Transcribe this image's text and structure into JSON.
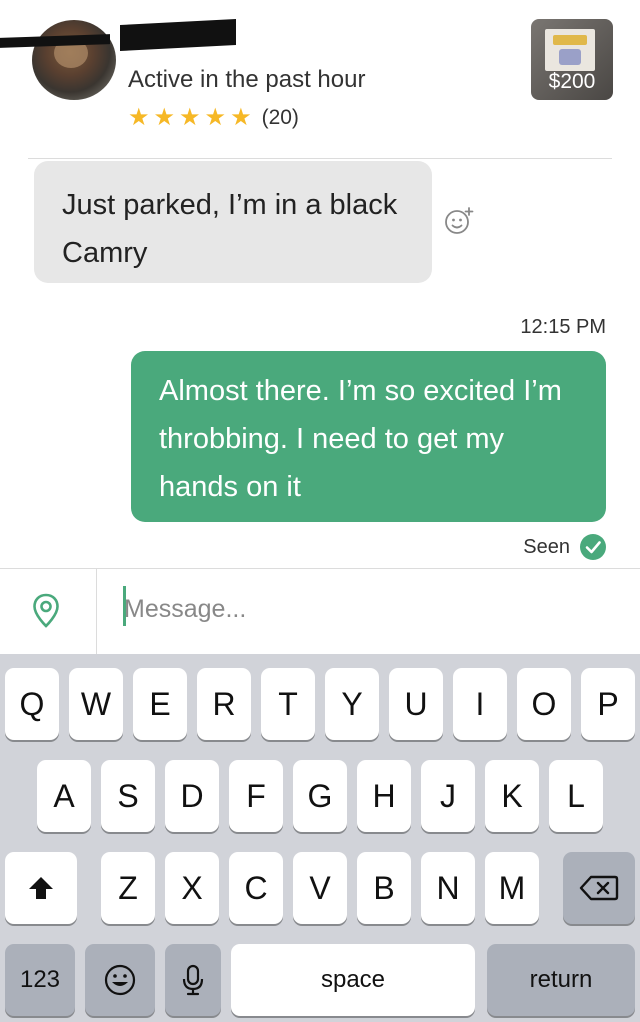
{
  "header": {
    "status": "Active in the past hour",
    "rating_count": "(20)",
    "stars": 5,
    "listing_price": "$200"
  },
  "messages": {
    "incoming_text": "Just parked, I’m in a black Camry",
    "timestamp": "12:15 PM",
    "outgoing_text": "Almost there. I’m so excited I’m throbbing. I need to get my hands on it",
    "seen_label": "Seen"
  },
  "composer": {
    "placeholder": "Message..."
  },
  "keyboard": {
    "row1": [
      "Q",
      "W",
      "E",
      "R",
      "T",
      "Y",
      "U",
      "I",
      "O",
      "P"
    ],
    "row2": [
      "A",
      "S",
      "D",
      "F",
      "G",
      "H",
      "J",
      "K",
      "L"
    ],
    "row3": [
      "Z",
      "X",
      "C",
      "V",
      "B",
      "N",
      "M"
    ],
    "numbers_label": "123",
    "space_label": "space",
    "return_label": "return"
  },
  "colors": {
    "accent": "#4aa97c",
    "star": "#f6b826",
    "incoming_bubble": "#e7e7e7",
    "keyboard_bg": "#d1d3d9"
  },
  "icons": {
    "emoji_react": "add-reaction-icon",
    "location": "location-pin-icon",
    "seen": "checkmark-icon",
    "shift": "shift-arrow-icon",
    "delete": "backspace-icon",
    "emoji": "emoji-icon",
    "dictation": "microphone-icon"
  }
}
